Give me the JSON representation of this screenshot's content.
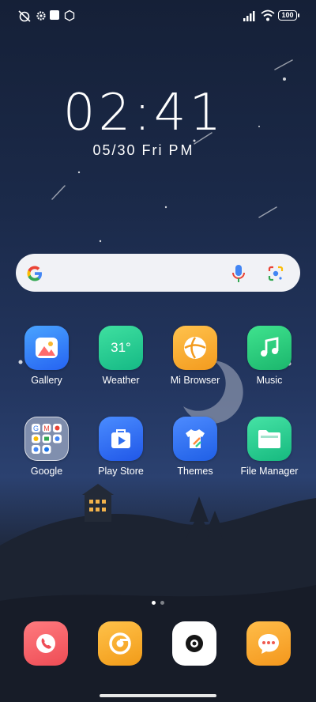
{
  "status_bar": {
    "battery": "100",
    "icons": [
      "alarm-off-icon",
      "settings-icon",
      "square-icon",
      "tv-icon",
      "signal-icon",
      "wifi-icon",
      "battery-icon"
    ]
  },
  "clock": {
    "time": "02:41",
    "date": "05/30",
    "day": "Fri",
    "period": "PM"
  },
  "search": {
    "icons": [
      "google-g-icon",
      "microphone-icon",
      "google-lens-icon"
    ]
  },
  "apps": [
    {
      "label": "Gallery",
      "color": "#2f7bff"
    },
    {
      "label": "Weather",
      "color": "#1fc98e",
      "temp": "31°"
    },
    {
      "label": "Mi Browser",
      "color": "#f7a92f"
    },
    {
      "label": "Music",
      "color": "#25d07c"
    },
    {
      "label": "Google",
      "color": "#b9c3d6"
    },
    {
      "label": "Play Store",
      "color": "#2f6fef"
    },
    {
      "label": "Themes",
      "color": "#2d6cf0"
    },
    {
      "label": "File Manager",
      "color": "#2ad18f"
    }
  ],
  "page_indicator": {
    "current": 1,
    "total": 2
  },
  "dock": [
    {
      "name": "phone",
      "color": "#f0585f"
    },
    {
      "name": "chrome-browser",
      "color": "#f6aa22"
    },
    {
      "name": "camera",
      "color": "#ffffff"
    },
    {
      "name": "messages",
      "color": "#f7a428"
    }
  ]
}
